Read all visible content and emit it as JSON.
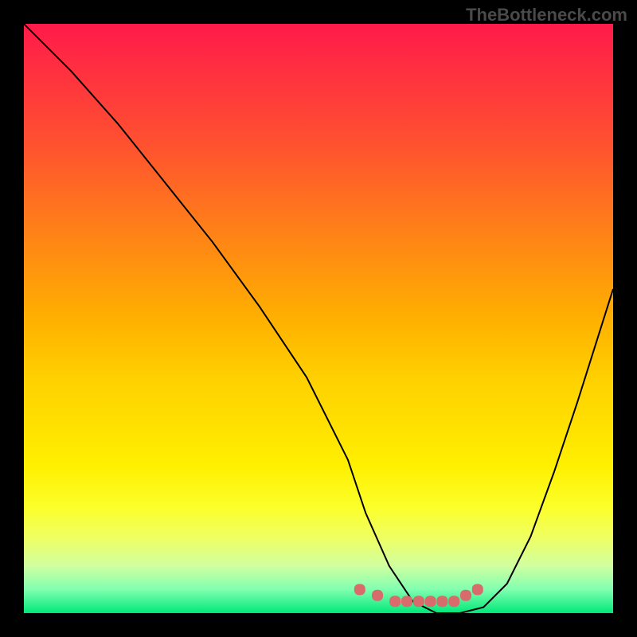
{
  "watermark": "TheBottleneck.com",
  "chart_data": {
    "type": "line",
    "title": "",
    "xlabel": "",
    "ylabel": "",
    "xlim": [
      0,
      100
    ],
    "ylim": [
      0,
      100
    ],
    "background_gradient": {
      "top_color": "#ff1a4a",
      "bottom_color": "#00e878",
      "description": "red (high bottleneck) to green (low bottleneck)"
    },
    "series": [
      {
        "name": "bottleneck-curve",
        "x": [
          0,
          8,
          16,
          24,
          32,
          40,
          48,
          55,
          58,
          62,
          66,
          70,
          74,
          78,
          82,
          86,
          90,
          94,
          100
        ],
        "values": [
          100,
          92,
          83,
          73,
          63,
          52,
          40,
          26,
          17,
          8,
          2,
          0,
          0,
          1,
          5,
          13,
          24,
          36,
          55
        ]
      }
    ],
    "highlight_points": {
      "name": "optimal-range",
      "x": [
        57,
        60,
        63,
        65,
        67,
        69,
        71,
        73,
        75,
        77
      ],
      "values": [
        4,
        3,
        2,
        2,
        2,
        2,
        2,
        2,
        3,
        4
      ]
    }
  }
}
